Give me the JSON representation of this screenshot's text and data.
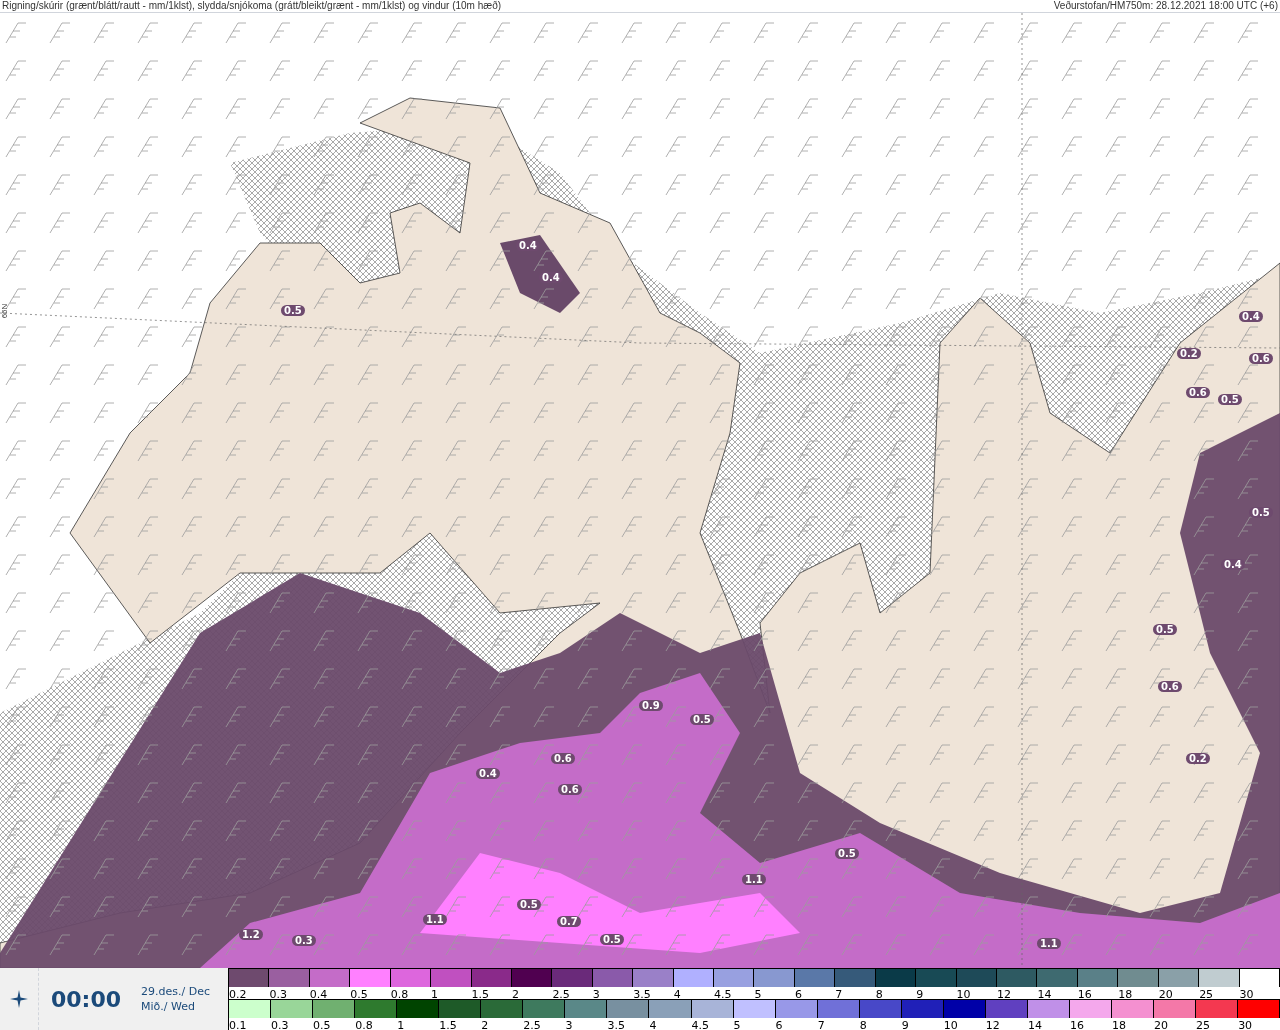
{
  "header": {
    "title": "Rigning/skúrir (grænt/blátt/rautt - mm/1klst), slydda/snjókoma (grátt/bleikt/grænt - mm/1klst) og vindur (10m hæð)",
    "source": "Veðurstofan/HM750m: 28.12.2021 18:00 UTC (+6)"
  },
  "map": {
    "latitude_label": "66N",
    "labels": [
      "0.4",
      "0.4",
      "0.5",
      "0.4",
      "0.2",
      "0.6",
      "0.6",
      "0.5",
      "0.5",
      "0.4",
      "0.5",
      "0.6",
      "0.9",
      "0.5",
      "0.2",
      "0.6",
      "0.4",
      "0.6",
      "0.5",
      "1.1",
      "0.5",
      "1.1",
      "0.7",
      "1.2",
      "0.3",
      "0.5",
      "1.1"
    ]
  },
  "time_panel": {
    "time": "00:00",
    "date": "29.des./ Dec",
    "weekday": "Mið./ Wed"
  },
  "legends": [
    {
      "items": [
        {
          "label": "0.2",
          "color": "#6e4a6e"
        },
        {
          "label": "0.3",
          "color": "#9a5fa0"
        },
        {
          "label": "0.4",
          "color": "#c46cc8"
        },
        {
          "label": "0.5",
          "color": "#ff80ff"
        },
        {
          "label": "0.8",
          "color": "#dd66dd"
        },
        {
          "label": "1",
          "color": "#c050c0"
        },
        {
          "label": "1.5",
          "color": "#8a2a8a"
        },
        {
          "label": "2",
          "color": "#500050"
        },
        {
          "label": "2.5",
          "color": "#6a2a7a"
        },
        {
          "label": "3",
          "color": "#8a5aaa"
        },
        {
          "label": "3.5",
          "color": "#9a80c8"
        },
        {
          "label": "4",
          "color": "#b0b0ff"
        },
        {
          "label": "4.5",
          "color": "#98a0e0"
        },
        {
          "label": "5",
          "color": "#8898d0"
        },
        {
          "label": "6",
          "color": "#5a78a8"
        },
        {
          "label": "7",
          "color": "#365a7a"
        },
        {
          "label": "8",
          "color": "#0a3a48"
        },
        {
          "label": "9",
          "color": "#184a55"
        },
        {
          "label": "10",
          "color": "#1e4a58"
        },
        {
          "label": "12",
          "color": "#2e5a62"
        },
        {
          "label": "14",
          "color": "#3e6a70"
        },
        {
          "label": "16",
          "color": "#5a8088"
        },
        {
          "label": "18",
          "color": "#708c90"
        },
        {
          "label": "20",
          "color": "#8aa0a8"
        },
        {
          "label": "25",
          "color": "#c0ccd0"
        },
        {
          "label": "30",
          "color": "#ffffff"
        }
      ]
    },
    {
      "items": [
        {
          "label": "0.1",
          "color": "#ccffcc"
        },
        {
          "label": "0.3",
          "color": "#99d699"
        },
        {
          "label": "0.5",
          "color": "#70b070"
        },
        {
          "label": "0.8",
          "color": "#2e7a2e"
        },
        {
          "label": "1",
          "color": "#004400"
        },
        {
          "label": "1.5",
          "color": "#1e5a28"
        },
        {
          "label": "2",
          "color": "#2a6a38"
        },
        {
          "label": "2.5",
          "color": "#3e7a5e"
        },
        {
          "label": "3",
          "color": "#5a8888"
        },
        {
          "label": "3.5",
          "color": "#7890a0"
        },
        {
          "label": "4",
          "color": "#8aa0b8"
        },
        {
          "label": "4.5",
          "color": "#a8b4d8"
        },
        {
          "label": "5",
          "color": "#c0c0ff"
        },
        {
          "label": "6",
          "color": "#9898e8"
        },
        {
          "label": "7",
          "color": "#7070d8"
        },
        {
          "label": "8",
          "color": "#4848c8"
        },
        {
          "label": "9",
          "color": "#2020b8"
        },
        {
          "label": "10",
          "color": "#0000a8"
        },
        {
          "label": "12",
          "color": "#6040c0"
        },
        {
          "label": "14",
          "color": "#c090e8"
        },
        {
          "label": "16",
          "color": "#f4a8ec"
        },
        {
          "label": "18",
          "color": "#f490d0"
        },
        {
          "label": "20",
          "color": "#f478a8"
        },
        {
          "label": "25",
          "color": "#f43850"
        },
        {
          "label": "30",
          "color": "#ff0000"
        }
      ]
    }
  ]
}
